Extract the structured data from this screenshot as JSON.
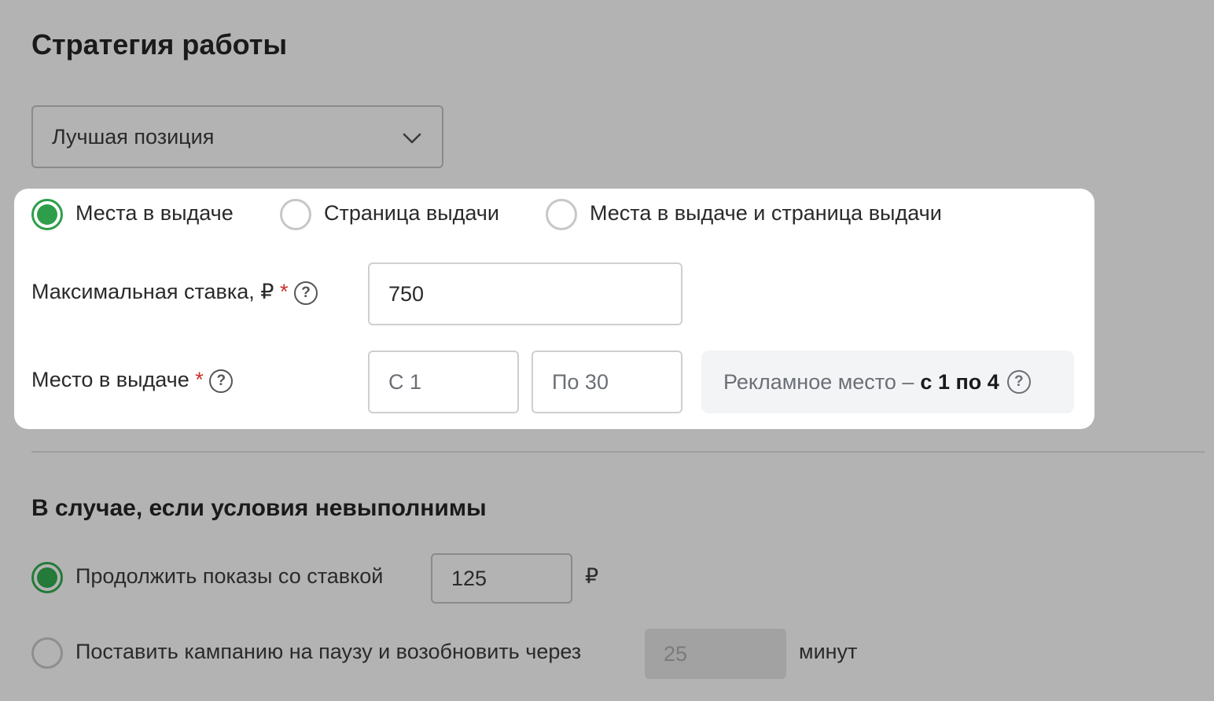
{
  "strategy": {
    "title": "Стратегия работы",
    "select_value": "Лучшая позиция"
  },
  "placement": {
    "options": [
      "Места в выдаче",
      "Страница выдачи",
      "Места в выдаче и страница выдачи"
    ],
    "selected_index": 0
  },
  "max_bid": {
    "label": "Максимальная ставка, ₽",
    "required_mark": "*",
    "value": "750"
  },
  "position": {
    "label": "Место в выдаче",
    "required_mark": "*",
    "from_value": "С 1",
    "to_value": "По 30",
    "hint_text": "Рекламное место –",
    "hint_bold": "с 1 по 4"
  },
  "fallback": {
    "title": "В случае, если условия невыполнимы",
    "continue_label": "Продолжить показы со ставкой",
    "continue_value": "125",
    "currency": "₽",
    "pause_label": "Поставить кампанию на паузу и возобновить через",
    "pause_value": "25",
    "pause_unit": "минут",
    "selected": "continue"
  },
  "colors": {
    "accent": "#2e9e4a",
    "required": "#c9302c",
    "overlay": "#b3b3b3"
  },
  "icons": {
    "help": "question-circle-icon",
    "dropdown": "chevron-down-icon"
  }
}
